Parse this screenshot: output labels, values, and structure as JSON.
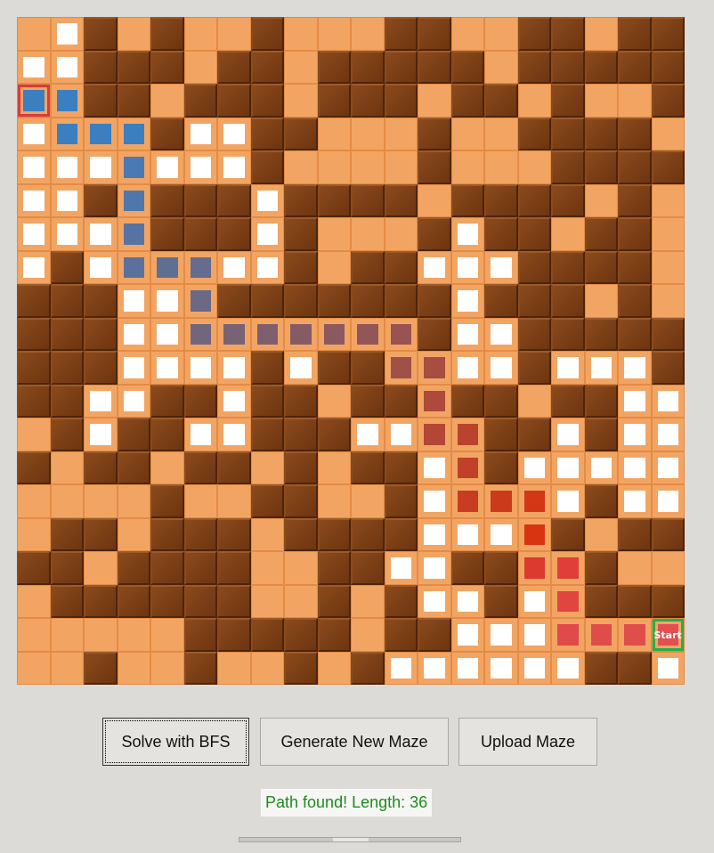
{
  "maze": {
    "rows": [
      "OVWOWOOWOOOWWOOWWOWW",
      "VVWWWOWWOWWWWWOWWWWW",
      "SSWWOWWWOWWWOWWOWOOW",
      "VSSSWVVWWOOOWOOWWWWO",
      "VVVSVVVWOOOOWOOOWWWW",
      "VVWSWWWVWWWWOWWWWOWO",
      "VVVSWWWVWOOOWVWWOWWO",
      "VWVSSSVVWOWWVVVWWWWO",
      "WWWVVSWWWWWWWVWWWOWO",
      "WWWVVSSSSSSSWVVWWWWW",
      "WWWVVVVWVWWSSVVWVVVW",
      "WWVVWWVWWOWWSWWOWWVV",
      "OWVWWVVWWWVVSSWWVWVV",
      "WOWWOWWOWOWWVSWVVVVV",
      "OOOOWOOWWOOWVSSSVWVV",
      "OWWOWWWOWWWWVVVSWOWW",
      "WWOWWWWOOWWVVWWSSWOO",
      "OWWWWWWOOWOWVVWVSWWW",
      "OOOOOWWWWWOWWVVVSSSG",
      "OOWOOWOOWOWVVVVVVWWV"
    ],
    "path_colors": [
      "#3b7fc0",
      "#3b7fc0",
      "#3b7fc0",
      "#3b7fc0",
      "#3b7fc0",
      "#4a79b3",
      "#4f77ab",
      "#5574a3",
      "#5b719b",
      "#5f6f94",
      "#656c8d",
      "#6b6984",
      "#72667d",
      "#786375",
      "#7f5f6d",
      "#855c66",
      "#8b595f",
      "#925658",
      "#995350",
      "#a05049",
      "#a74d42",
      "#ad4a3b",
      "#b34735",
      "#ba432e",
      "#c04028",
      "#c63d22",
      "#cc3a1c",
      "#d23716",
      "#d83411",
      "#dc3a2e",
      "#de3f38",
      "#e04540",
      "#e04a48",
      "#e04c4a",
      "#e04e4c",
      "#e05050"
    ],
    "goal_label": "Start"
  },
  "buttons": {
    "solve": "Solve with BFS",
    "generate": "Generate New Maze",
    "upload": "Upload Maze"
  },
  "status": {
    "text": "Path found! Length: 36",
    "color": "#1f8a1f"
  }
}
